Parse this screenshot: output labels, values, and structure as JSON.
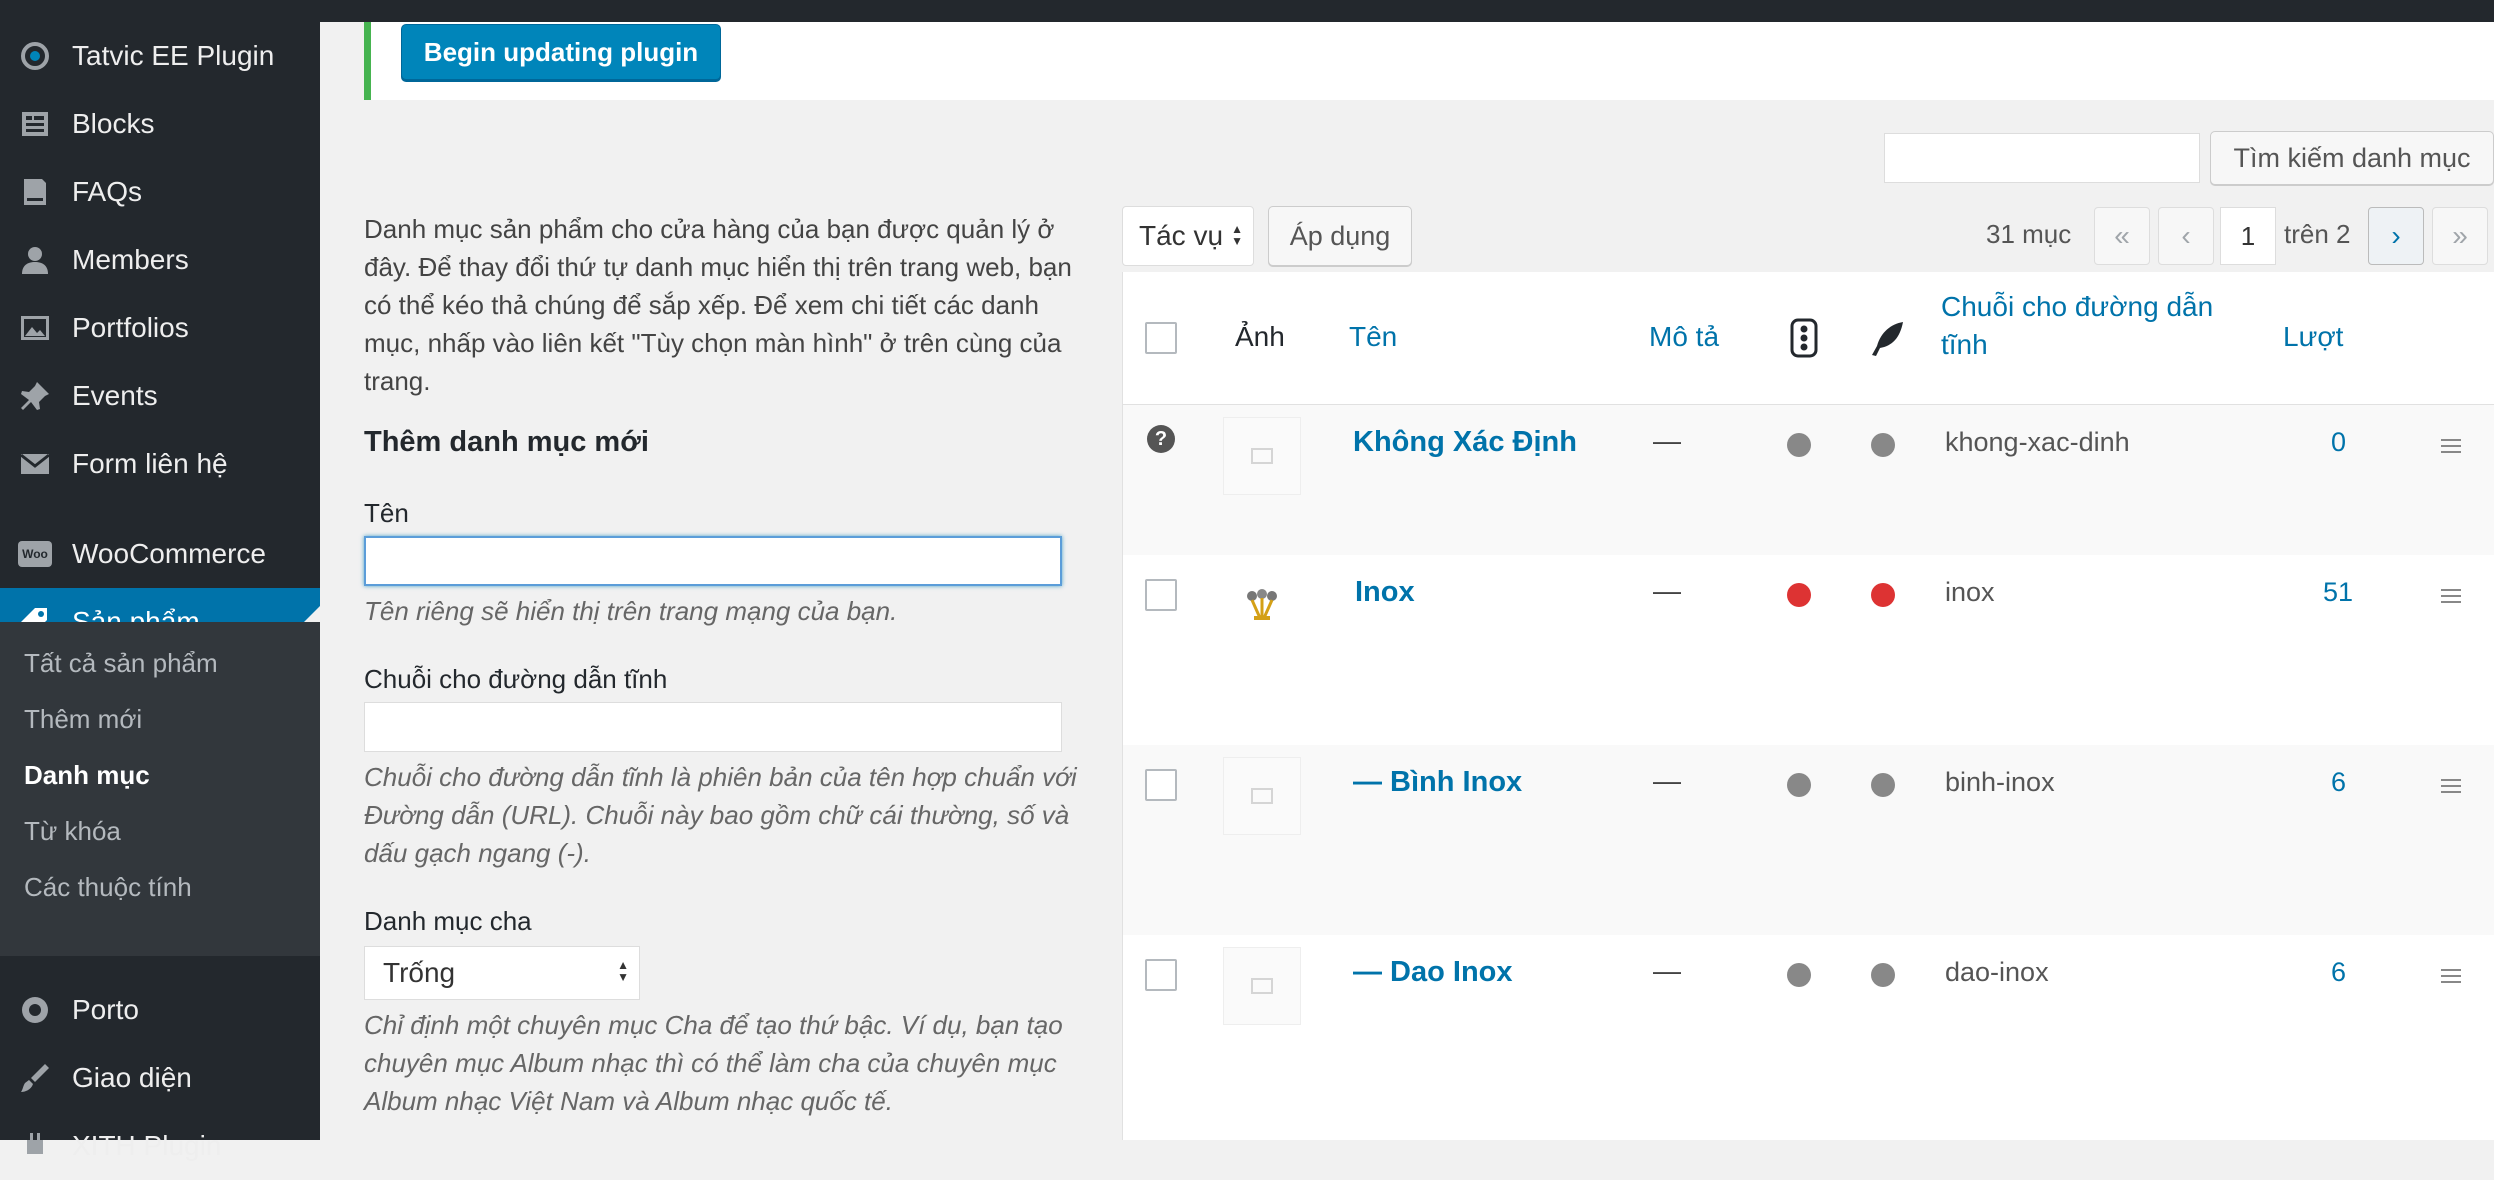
{
  "colors": {
    "sidebar": "#23282d",
    "accent": "#0073aa",
    "notice_border": "#46b450",
    "red": "#dd3333",
    "gray": "#888888"
  },
  "sidebar": {
    "items": [
      {
        "label": "Tatvic EE Plugin",
        "icon": "tatvic-icon"
      },
      {
        "label": "Blocks",
        "icon": "blocks-icon"
      },
      {
        "label": "FAQs",
        "icon": "faqs-icon"
      },
      {
        "label": "Members",
        "icon": "members-icon"
      },
      {
        "label": "Portfolios",
        "icon": "portfolios-icon"
      },
      {
        "label": "Events",
        "icon": "pin-icon"
      },
      {
        "label": "Form liên hệ",
        "icon": "mail-icon"
      },
      {
        "label": "WooCommerce",
        "icon": "woocommerce-icon"
      },
      {
        "label": "Sản phẩm",
        "icon": "product-icon"
      },
      {
        "label": "Porto",
        "icon": "porto-icon"
      },
      {
        "label": "Giao diện",
        "icon": "appearance-icon"
      },
      {
        "label": "XITH Plugin",
        "icon": "plugin-icon"
      }
    ],
    "woo_badge": "Woo",
    "submenu": [
      "Tất cả sản phẩm",
      "Thêm mới",
      "Danh mục",
      "Từ khóa",
      "Các thuộc tính"
    ]
  },
  "notice": {
    "button": "Begin updating plugin"
  },
  "search": {
    "button": "Tìm kiếm danh mục",
    "value": ""
  },
  "form": {
    "intro": "Danh mục sản phẩm cho cửa hàng của bạn được quản lý ở đây. Để thay đổi thứ tự danh mục hiển thị trên trang web, bạn có thể kéo thả chúng để sắp xếp. Để xem chi tiết các danh mục, nhấp vào liên kết \"Tùy chọn màn hình\" ở trên cùng của trang.",
    "title": "Thêm danh mục mới",
    "name_label": "Tên",
    "name_value": "",
    "name_help": "Tên riêng sẽ hiển thị trên trang mạng của bạn.",
    "slug_label": "Chuỗi cho đường dẫn tĩnh",
    "slug_value": "",
    "slug_help": "Chuỗi cho đường dẫn tĩnh là phiên bản của tên hợp chuẩn với Đường dẫn (URL). Chuỗi này bao gồm chữ cái thường, số và dấu gạch ngang (-).",
    "parent_label": "Danh mục cha",
    "parent_value": "Trống",
    "parent_help": "Chỉ định một chuyên mục Cha để tạo thứ bậc. Ví dụ, bạn tạo chuyên mục Album nhạc thì có thể làm cha của chuyên mục Album nhạc Việt Nam và Album nhạc quốc tế."
  },
  "toolbar": {
    "bulk_action": "Tác vụ",
    "apply": "Áp dụng",
    "count": "31 mục",
    "first": "«",
    "prev": "‹",
    "page": "1",
    "of": "trên 2",
    "next": "›",
    "last": "»"
  },
  "table": {
    "headers": {
      "image": "Ảnh",
      "name": "Tên",
      "desc": "Mô tả",
      "slug": "Chuỗi cho đường dẫn tĩnh",
      "count": "Lượt"
    },
    "rows": [
      {
        "name": "Không Xác Định",
        "desc": "—",
        "dot1": "#888888",
        "dot2": "#888888",
        "slug": "khong-xac-dinh",
        "count": "0"
      },
      {
        "name": "Inox",
        "desc": "—",
        "dot1": "#dd3333",
        "dot2": "#dd3333",
        "slug": "inox",
        "count": "51"
      },
      {
        "name": "— Bình Inox",
        "desc": "—",
        "dot1": "#888888",
        "dot2": "#888888",
        "slug": "binh-inox",
        "count": "6"
      },
      {
        "name": "— Dao Inox",
        "desc": "—",
        "dot1": "#888888",
        "dot2": "#888888",
        "slug": "dao-inox",
        "count": "6"
      }
    ]
  }
}
